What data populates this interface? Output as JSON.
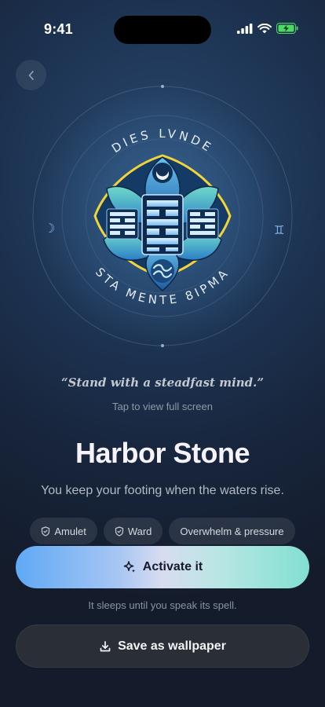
{
  "status_bar": {
    "time": "9:41"
  },
  "sigil": {
    "top_inscription": "DIES LVNDE",
    "bottom_inscription": "STA MENTE 8IPMA",
    "left_glyph": "☽",
    "right_glyph": "♊"
  },
  "quote": "“Stand with a steadfast mind.”",
  "tap_hint": "Tap to view full screen",
  "title": "Harbor Stone",
  "subtitle": "You keep your footing when the waters rise.",
  "tags": [
    {
      "label": "Amulet",
      "icon": "shield-icon"
    },
    {
      "label": "Ward",
      "icon": "shield-icon"
    },
    {
      "label": "Overwhelm & pressure"
    }
  ],
  "activate_label": "Activate it",
  "sleep_note": "It sleeps until you speak its spell.",
  "save_label": "Save as wallpaper",
  "colors": {
    "accent_blue": "#60a9f5",
    "accent_teal": "#82dfd2",
    "background_top": "#2b4a70",
    "background_bottom": "#141c2c"
  }
}
